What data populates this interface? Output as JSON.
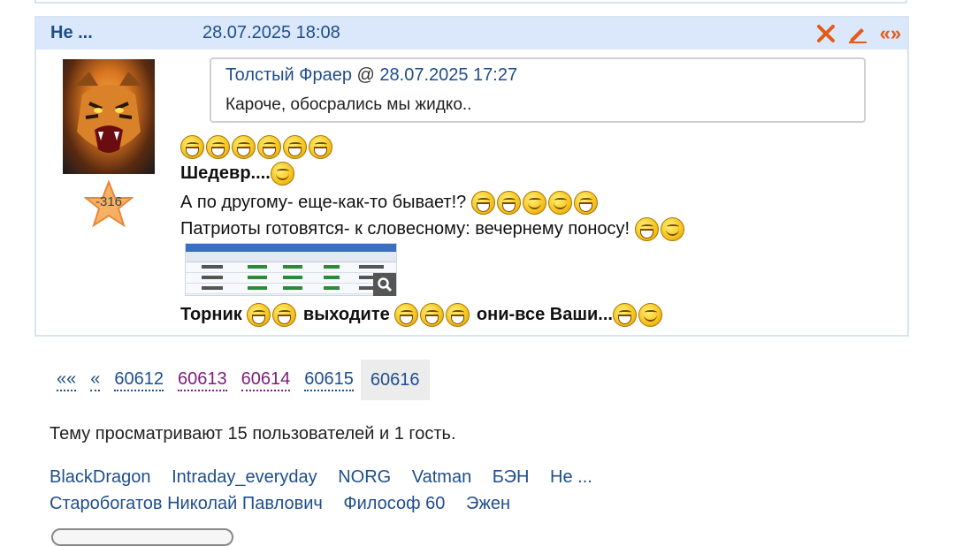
{
  "post": {
    "author": "Не ...",
    "date": "28.07.2025 18:08",
    "rating": "-316",
    "icons": [
      "delete-icon",
      "edit-pencil-icon",
      "quote-icon"
    ],
    "quote_label": "«»",
    "quote": {
      "author": "Толстый Фраер",
      "at": " @ ",
      "date": "28.07.2025 17:27",
      "text": "Кароче, обосрались мы жидко.."
    },
    "lines": {
      "shedevr": "Шедевр....",
      "po_drugomu": "А по другому- еще-как-то бывает!?",
      "patrioty": "Патриоты готовятся- к словесному: вечернему поносу!",
      "tornik": "Торник",
      "vyhodite": "выходите",
      "oni_vse": "они-все Ваши..."
    }
  },
  "pagination": {
    "first": "««",
    "prev": "«",
    "pages": [
      "60612",
      "60613",
      "60614",
      "60615"
    ],
    "current": "60616"
  },
  "viewers_text": "Тему просматривают 15 пользователей и 1 гость.",
  "users": [
    "BlackDragon",
    "Intraday_everyday",
    "NORG",
    "Vatman",
    "БЭН",
    "Не ...",
    "Старобогатов Николай Павлович",
    "Философ 60",
    "Эжен"
  ],
  "colors": {
    "link": "#1f4e8c",
    "visited": "#7a1e7a",
    "header_bg": "#dbe8fb",
    "action_orange": "#e25b19"
  }
}
